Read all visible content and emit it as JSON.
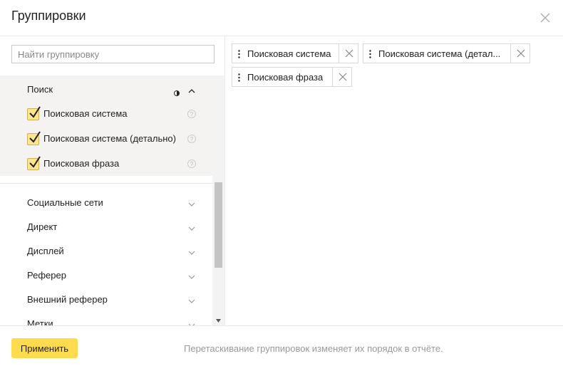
{
  "dialog": {
    "title": "Группировки"
  },
  "search": {
    "placeholder": "Найти группировку",
    "value": ""
  },
  "groups": [
    {
      "label": "Поиск",
      "expanded": true,
      "items": [
        {
          "label": "Поисковая система",
          "checked": true
        },
        {
          "label": "Поисковая система (детально)",
          "checked": true
        },
        {
          "label": "Поисковая фраза",
          "checked": true
        }
      ]
    },
    {
      "label": "Социальные сети",
      "expanded": false
    },
    {
      "label": "Директ",
      "expanded": false
    },
    {
      "label": "Дисплей",
      "expanded": false
    },
    {
      "label": "Реферер",
      "expanded": false
    },
    {
      "label": "Внешний реферер",
      "expanded": false
    },
    {
      "label": "Метки",
      "expanded": false
    }
  ],
  "selected": [
    {
      "label": "Поисковая система"
    },
    {
      "label": "Поисковая система (детал..."
    },
    {
      "label": "Поисковая фраза"
    }
  ],
  "footer": {
    "apply_label": "Применить",
    "hint": "Перетаскивание группировок изменяет их порядок в отчёте."
  },
  "colors": {
    "accent": "#ffdb4d",
    "checkbox": "#fde58d",
    "group_bg": "#f4f3f2"
  }
}
